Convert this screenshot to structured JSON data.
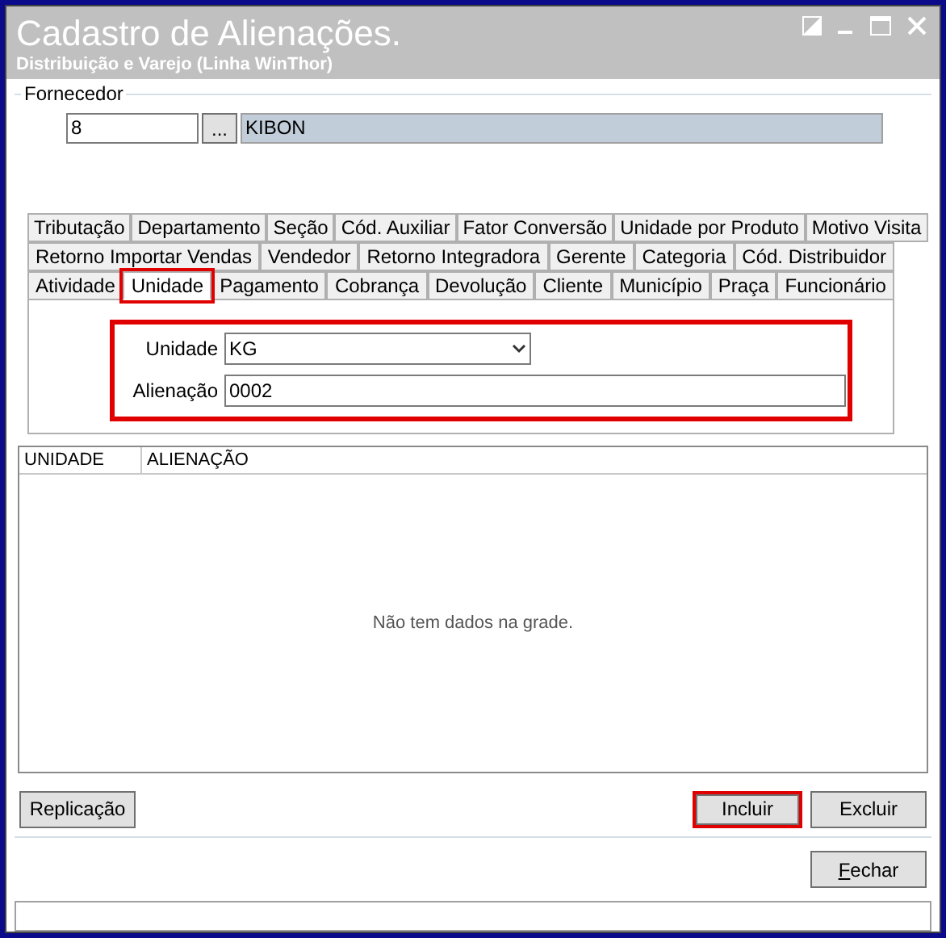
{
  "window": {
    "title": "Cadastro de Alienações.",
    "subtitle": "Distribuição e Varejo (Linha WinThor)"
  },
  "fornecedor": {
    "label": "Fornecedor",
    "code": "8",
    "lookup_button": "...",
    "name": "KIBON"
  },
  "tab_rows": [
    [
      {
        "label": "Tributação",
        "selected": false,
        "highlighted": false
      },
      {
        "label": "Departamento",
        "selected": false,
        "highlighted": false
      },
      {
        "label": "Seção",
        "selected": false,
        "highlighted": false
      },
      {
        "label": "Cód. Auxiliar",
        "selected": false,
        "highlighted": false
      },
      {
        "label": "Fator Conversão",
        "selected": false,
        "highlighted": false
      },
      {
        "label": "Unidade por Produto",
        "selected": false,
        "highlighted": false
      },
      {
        "label": "Motivo Visita",
        "selected": false,
        "highlighted": false
      }
    ],
    [
      {
        "label": "Retorno Importar Vendas",
        "selected": false,
        "highlighted": false
      },
      {
        "label": "Vendedor",
        "selected": false,
        "highlighted": false
      },
      {
        "label": "Retorno Integradora",
        "selected": false,
        "highlighted": false
      },
      {
        "label": "Gerente",
        "selected": false,
        "highlighted": false
      },
      {
        "label": "Categoria",
        "selected": false,
        "highlighted": false
      },
      {
        "label": "Cód. Distribuidor",
        "selected": false,
        "highlighted": false
      }
    ],
    [
      {
        "label": "Atividade",
        "selected": false,
        "highlighted": false
      },
      {
        "label": "Unidade",
        "selected": true,
        "highlighted": true
      },
      {
        "label": "Pagamento",
        "selected": false,
        "highlighted": false
      },
      {
        "label": "Cobrança",
        "selected": false,
        "highlighted": false
      },
      {
        "label": "Devolução",
        "selected": false,
        "highlighted": false
      },
      {
        "label": "Cliente",
        "selected": false,
        "highlighted": false
      },
      {
        "label": "Município",
        "selected": false,
        "highlighted": false
      },
      {
        "label": "Praça",
        "selected": false,
        "highlighted": false
      },
      {
        "label": "Funcionário",
        "selected": false,
        "highlighted": false
      }
    ]
  ],
  "form": {
    "highlighted": true,
    "unidade": {
      "label": "Unidade",
      "value": "KG"
    },
    "alienacao": {
      "label": "Alienação",
      "value": "0002"
    }
  },
  "grid": {
    "columns": [
      "UNIDADE",
      "ALIENAÇÃO"
    ],
    "empty_message": "Não tem dados na grade."
  },
  "buttons": [
    {
      "label": "Replicação",
      "highlighted": false
    },
    {
      "label": "Incluir",
      "highlighted": true
    },
    {
      "label": "Excluir",
      "highlighted": false
    }
  ],
  "close_button": {
    "label": "Fechar"
  }
}
